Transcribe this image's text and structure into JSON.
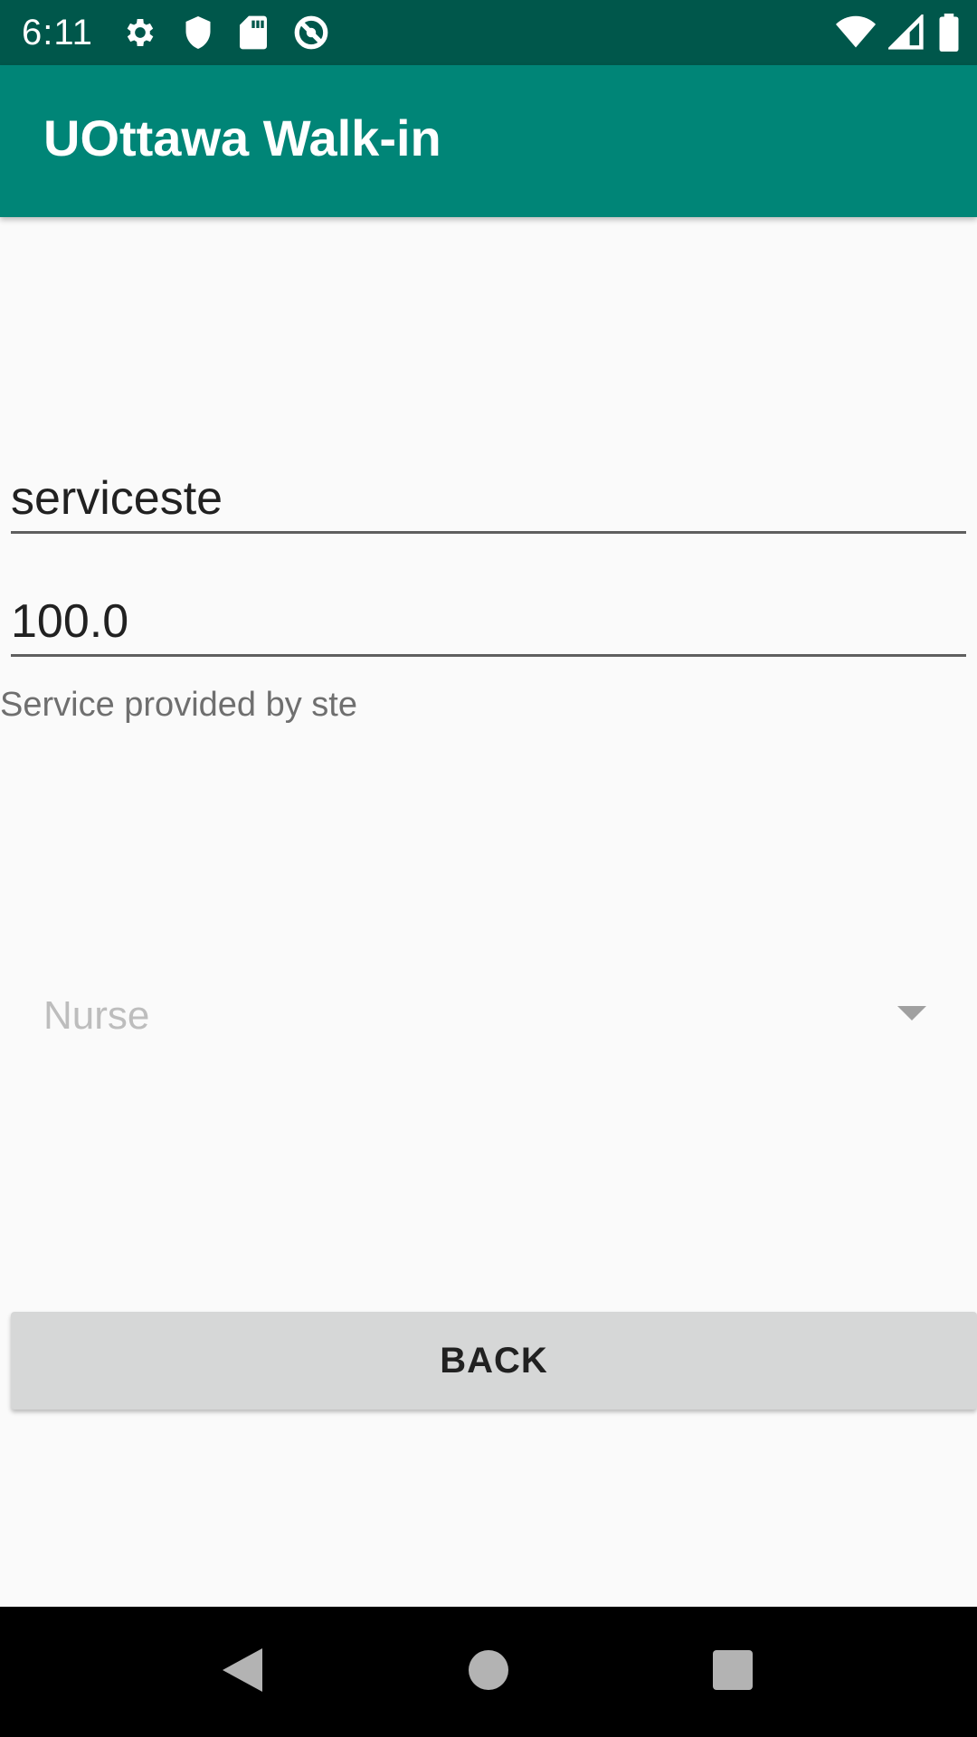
{
  "status_bar": {
    "time": "6:11",
    "left_icons": [
      "gear-icon",
      "shield-icon",
      "sd-card-icon",
      "data-saver-icon"
    ],
    "right_icons": [
      "wifi-icon",
      "cellular-signal-icon",
      "battery-icon"
    ]
  },
  "app_bar": {
    "title": "UOttawa Walk-in",
    "color": "#008577"
  },
  "form": {
    "service_name_value": "serviceste",
    "rate_value": "100.0",
    "provider_text": "Service provided by ste",
    "role_spinner_value": "Nurse",
    "back_button_label": "BACK"
  },
  "nav_bar": {
    "buttons": [
      "back-icon",
      "home-icon",
      "recents-icon"
    ]
  },
  "colors": {
    "status_bar": "#00574b",
    "accent": "#008577",
    "background": "#fafafa",
    "button": "#d6d7d7"
  }
}
